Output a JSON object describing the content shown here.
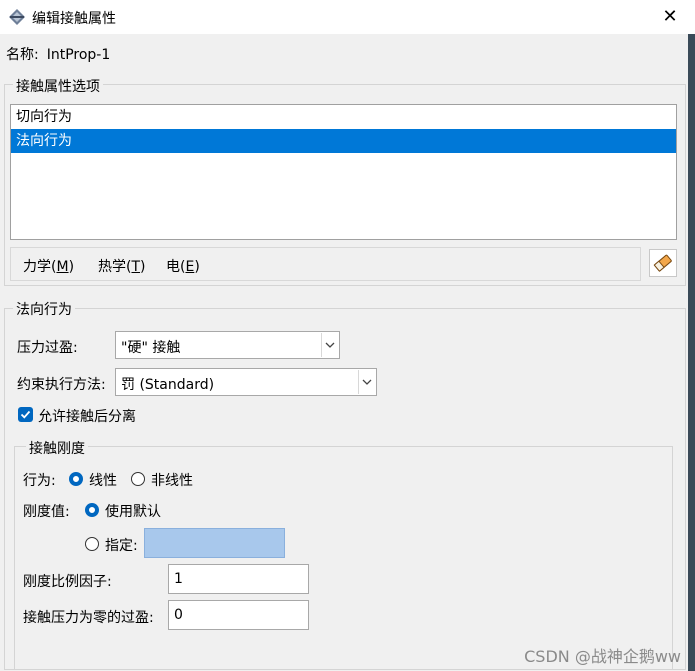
{
  "window": {
    "title": "编辑接触属性",
    "close_glyph": "✕"
  },
  "name": {
    "label": "名称:",
    "value": "IntProp-1"
  },
  "options_group": {
    "title": "接触属性选项",
    "items": [
      {
        "label": "切向行为",
        "selected": false
      },
      {
        "label": "法向行为",
        "selected": true
      }
    ]
  },
  "menu": {
    "mechanical": {
      "text": "力学(",
      "key": "M",
      "end": ")"
    },
    "thermal": {
      "text": "热学(",
      "key": "T",
      "end": ")"
    },
    "electrical": {
      "text": "电(",
      "key": "E",
      "end": ")"
    },
    "eraser_icon": "eraser-icon"
  },
  "normal_group": {
    "title": "法向行为",
    "pressure_overclosure": {
      "label": "压力过盈:",
      "value": "\"硬\" 接触"
    },
    "constraint_method": {
      "label": "约束执行方法:",
      "value": "罚 (Standard)"
    },
    "allow_separation": {
      "label": "允许接触后分离",
      "checked": true
    }
  },
  "stiffness_group": {
    "title": "接触刚度",
    "behavior_label": "行为:",
    "linear_label": "线性",
    "nonlinear_label": "非线性",
    "behavior_selected": "linear",
    "stiffness_value_label": "刚度值:",
    "use_default_label": "使用默认",
    "specify_label": "指定:",
    "stiffness_value_selected": "use_default",
    "specify_value": "",
    "scale_factor_label": "刚度比例因子:",
    "scale_factor_value": "1",
    "zero_pressure_clearance_label": "接触压力为零的过盈:",
    "zero_pressure_clearance_value": "0"
  },
  "watermark": "CSDN @战神企鹅ww",
  "colors": {
    "selection": "#0078d7",
    "accent": "#0067c0",
    "disabled_field": "#a8c8ec"
  }
}
